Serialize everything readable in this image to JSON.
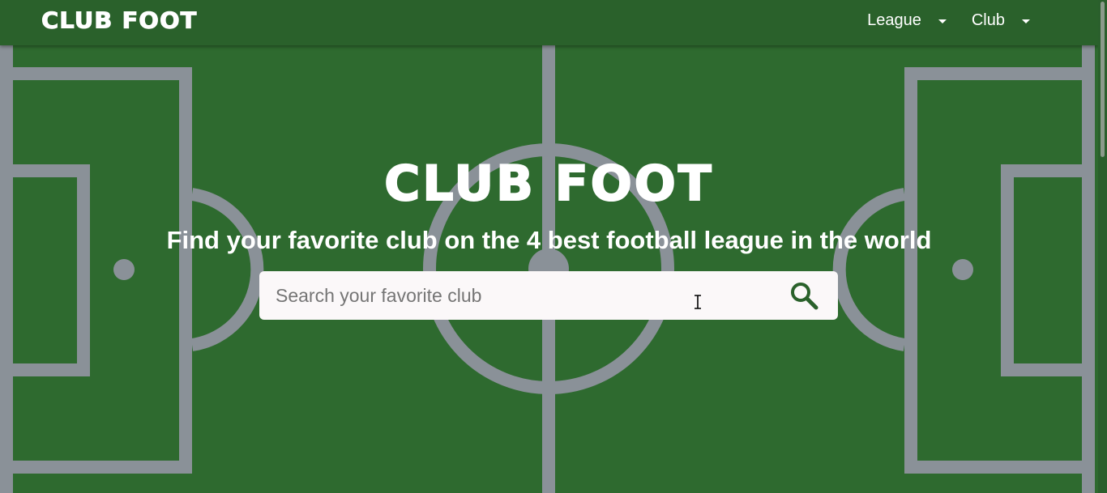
{
  "navbar": {
    "brand": "CLUB FOOT",
    "menu": [
      {
        "label": "League"
      },
      {
        "label": "Club"
      }
    ]
  },
  "hero": {
    "title": "CLUB FOOT",
    "subtitle": "Find your favorite club on the 4 best football league in the world"
  },
  "search": {
    "placeholder": "Search your favorite club",
    "value": ""
  },
  "colors": {
    "nav_background": "#2a612b",
    "pitch_green": "#2e6a2f",
    "pitch_lines": "#8a9198",
    "search_background": "#fbf8f9",
    "search_icon": "#2a612b"
  },
  "icons": {
    "search": "search-icon",
    "caret": "caret-down-icon"
  }
}
